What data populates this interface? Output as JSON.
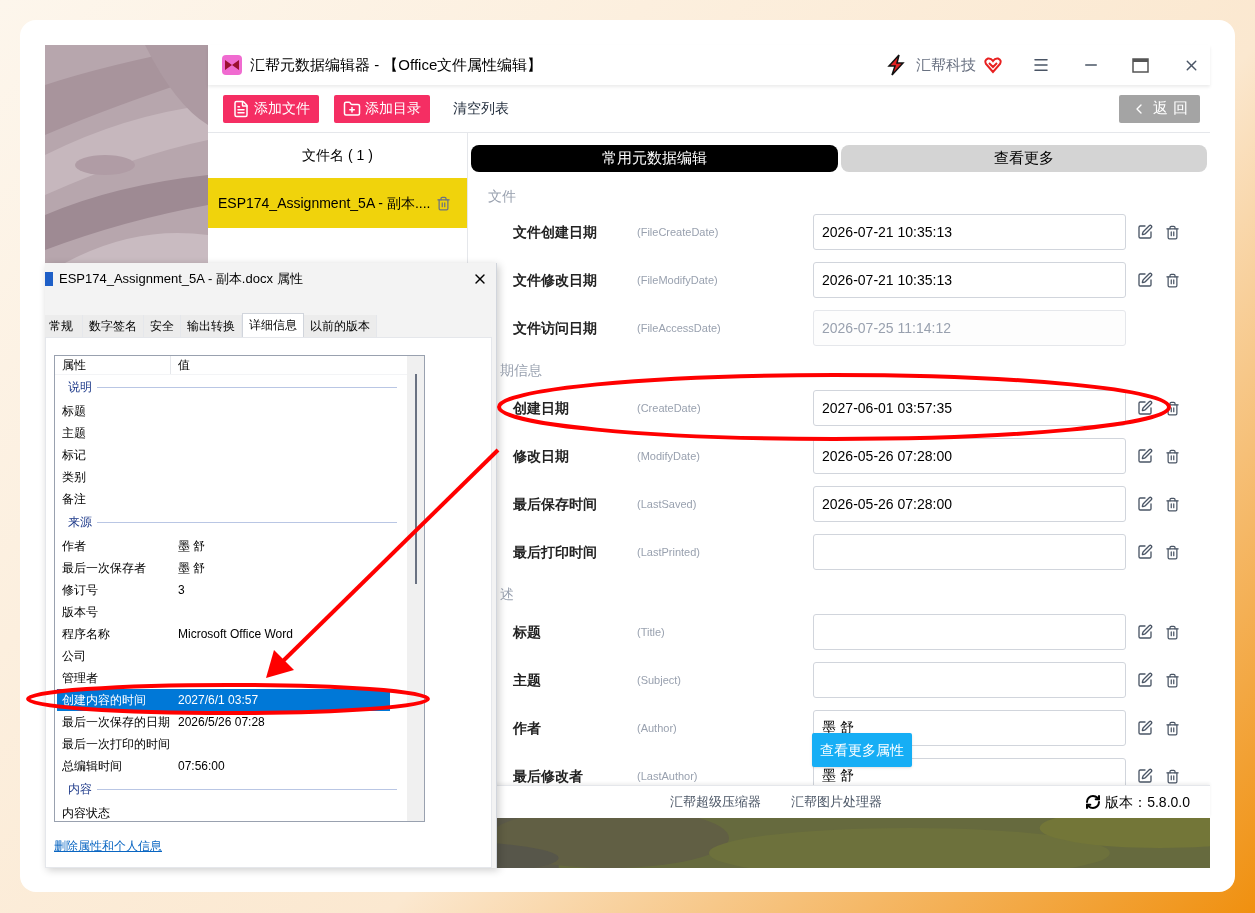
{
  "app": {
    "title": "汇帮元数据编辑器 - 【Office文件属性编辑】",
    "brand": "汇帮科技"
  },
  "toolbar": {
    "buttons": [
      {
        "label": "添加文件",
        "kind": "file"
      },
      {
        "label": "添加目录",
        "kind": "folder"
      },
      {
        "label": "清空列表",
        "kind": "plain"
      }
    ],
    "back": "返 回"
  },
  "file_list": {
    "header": "文件名 ( 1 )",
    "files": [
      {
        "name": "ESP174_Assignment_5A - 副本....",
        "selected": true
      }
    ]
  },
  "tabs": [
    {
      "label": "常用元数据编辑",
      "selected": true
    },
    {
      "label": "查看更多",
      "selected": false
    }
  ],
  "sections": [
    {
      "title": "文件",
      "fields": [
        {
          "label": "文件创建日期",
          "key": "(FileCreateDate)",
          "value": "2026-07-21 10:35:13",
          "disabled": false
        },
        {
          "label": "文件修改日期",
          "key": "(FileModifyDate)",
          "value": "2026-07-21 10:35:13",
          "disabled": false
        },
        {
          "label": "文件访问日期",
          "key": "(FileAccessDate)",
          "value": "2026-07-25 11:14:12",
          "disabled": true
        }
      ]
    },
    {
      "title": "期信息",
      "fields": [
        {
          "label": "创建日期",
          "key": "(CreateDate)",
          "value": "2027-06-01 03:57:35",
          "disabled": false
        },
        {
          "label": "修改日期",
          "key": "(ModifyDate)",
          "value": "2026-05-26 07:28:00",
          "disabled": false
        },
        {
          "label": "最后保存时间",
          "key": "(LastSaved)",
          "value": "2026-05-26 07:28:00",
          "disabled": false
        },
        {
          "label": "最后打印时间",
          "key": "(LastPrinted)",
          "disabled": false
        }
      ]
    },
    {
      "title": "述",
      "fields": [
        {
          "label": "标题",
          "key": "(Title)",
          "disabled": false
        },
        {
          "label": "主题",
          "key": "(Subject)",
          "disabled": false
        },
        {
          "label": "作者",
          "key": "(Author)",
          "value": "墨 舒",
          "disabled": false
        },
        {
          "label": "最后修改者",
          "key": "(LastAuthor)",
          "value": "墨 舒",
          "disabled": false
        }
      ]
    }
  ],
  "tooltip": "查看更多属性",
  "footer": {
    "links": [
      "汇帮超级压缩器",
      "汇帮图片处理器"
    ],
    "version": "版本：5.8.0.0"
  },
  "dialog": {
    "title": "ESP174_Assignment_5A - 副本.docx 属性",
    "tabs": [
      {
        "label": "常规",
        "selected": false
      },
      {
        "label": "数字签名",
        "selected": false
      },
      {
        "label": "安全",
        "selected": false
      },
      {
        "label": "输出转换",
        "selected": false
      },
      {
        "label": "详细信息",
        "selected": true
      },
      {
        "label": "以前的版本",
        "selected": false
      }
    ],
    "columns": [
      "属性",
      "值"
    ],
    "groups": [
      {
        "title": "说明",
        "rows": [
          {
            "name": "标题",
            "selected": false
          },
          {
            "name": "主题",
            "selected": false
          },
          {
            "name": "标记",
            "selected": false
          },
          {
            "name": "类别",
            "selected": false
          },
          {
            "name": "备注",
            "selected": false
          }
        ]
      },
      {
        "title": "来源",
        "rows": [
          {
            "name": "作者",
            "value": "墨 舒",
            "selected": false
          },
          {
            "name": "最后一次保存者",
            "value": "墨 舒",
            "selected": false
          },
          {
            "name": "修订号",
            "value": "3",
            "selected": false
          },
          {
            "name": "版本号",
            "selected": false
          },
          {
            "name": "程序名称",
            "value": "Microsoft Office Word",
            "selected": false
          },
          {
            "name": "公司",
            "selected": false
          },
          {
            "name": "管理者",
            "selected": false
          },
          {
            "name": "创建内容的时间",
            "value": "2027/6/1 03:57",
            "selected": true
          },
          {
            "name": "最后一次保存的日期",
            "value": "2026/5/26 07:28",
            "selected": false
          },
          {
            "name": "最后一次打印的时间",
            "selected": false
          },
          {
            "name": "总编辑时间",
            "value": "07:56:00",
            "selected": false
          }
        ]
      },
      {
        "title": "内容",
        "rows": [
          {
            "name": "内容状态",
            "selected": false
          }
        ]
      }
    ],
    "link": "删除属性和个人信息"
  }
}
